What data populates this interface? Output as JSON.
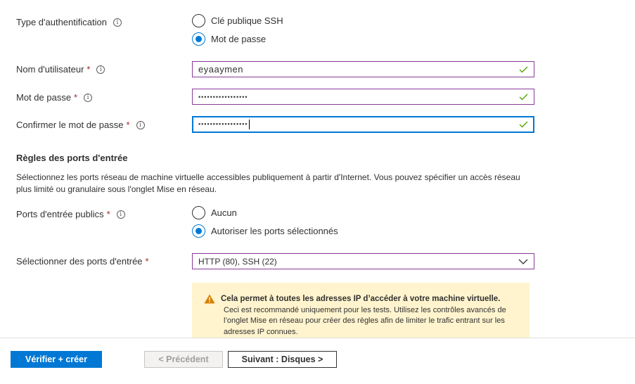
{
  "auth": {
    "label": "Type d'authentification",
    "options": [
      "Clé publique SSH",
      "Mot de passe"
    ],
    "selected_index": 1
  },
  "username": {
    "label": "Nom d'utilisateur",
    "value": "eyaaymen"
  },
  "password": {
    "label": "Mot de passe",
    "value": "•••••••••••••••••"
  },
  "confirm_password": {
    "label": "Confirmer le mot de passe",
    "value": "•••••••••••••••••"
  },
  "required_mark": "*",
  "info_glyph": "i",
  "inbound": {
    "section_title": "Règles des ports d'entrée",
    "description": "Sélectionnez les ports réseau de machine virtuelle accessibles publiquement à partir d'Internet. Vous pouvez spécifier un accès réseau plus limité ou granulaire sous l'onglet Mise en réseau.",
    "public_ports_label": "Ports d'entrée publics",
    "public_ports_options": [
      "Aucun",
      "Autoriser les ports sélectionnés"
    ],
    "public_ports_selected_index": 1,
    "select_ports_label": "Sélectionner des ports d'entrée",
    "select_ports_value": "HTTP (80), SSH (22)"
  },
  "warning": {
    "title": "Cela permet à toutes les adresses IP d’accéder à votre machine virtuelle.",
    "body": "Ceci est recommandé uniquement pour les tests.  Utilisez les contrôles avancés de l’onglet Mise en réseau pour créer des règles afin de limiter le trafic entrant sur les adresses IP connues."
  },
  "footer": {
    "review_create": "Vérifier + créer",
    "previous": "< Précédent",
    "next": "Suivant : Disques >"
  },
  "colors": {
    "accent": "#0078d4",
    "required": "#a4262c",
    "valid_check": "#57a300",
    "warning_bg": "#fff4ce",
    "warning_icon": "#d67f00",
    "field_border": "#8a3a9a"
  }
}
